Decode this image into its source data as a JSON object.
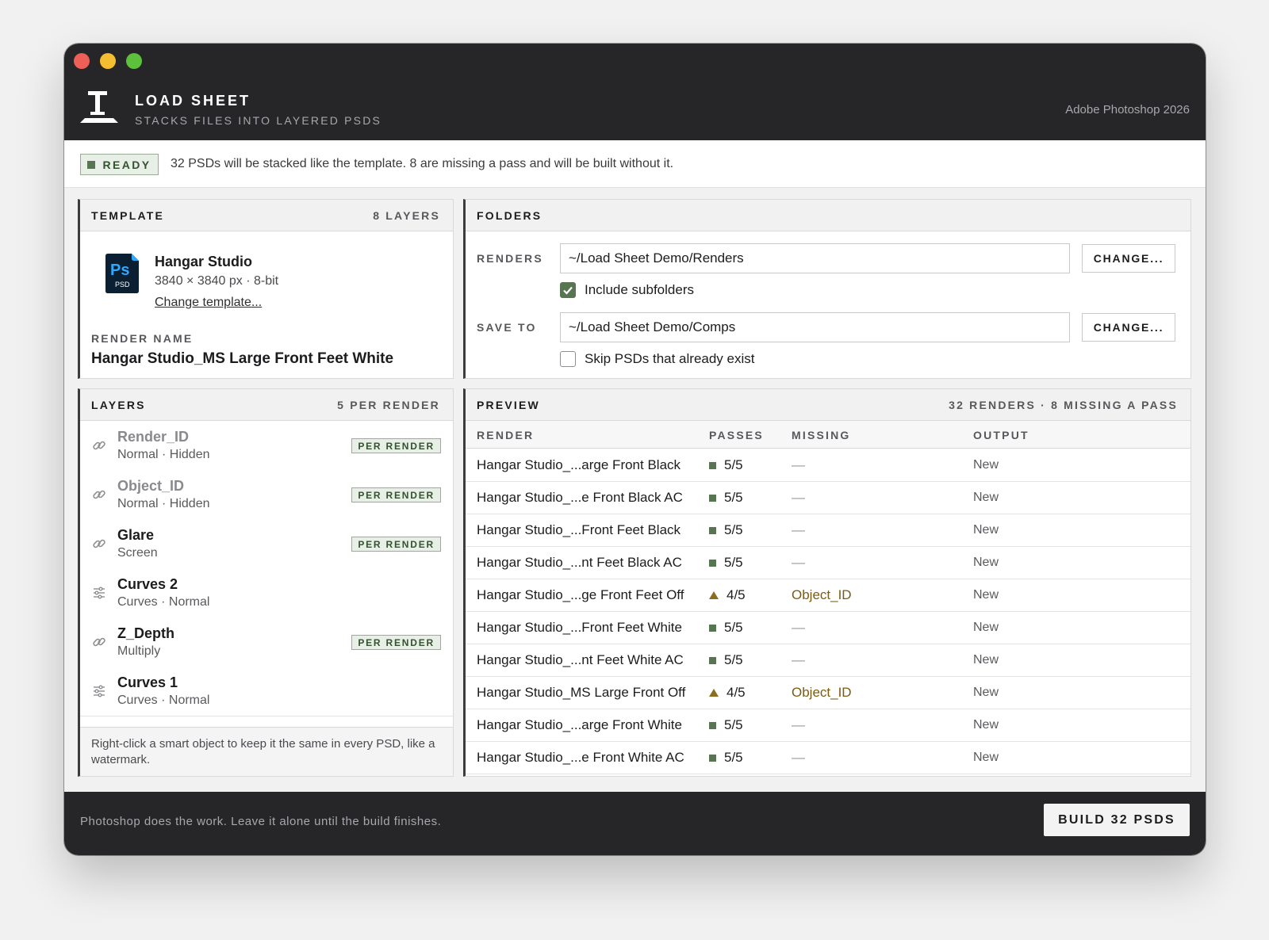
{
  "app": {
    "title": "LOAD SHEET",
    "subtitle": "STACKS FILES INTO LAYERED PSDS",
    "host": "Adobe Photoshop 2026"
  },
  "status": {
    "badge": "READY",
    "message": "32 PSDs will be stacked like the template. 8 are missing a pass and will be built without it."
  },
  "template": {
    "heading": "TEMPLATE",
    "layer_count": "8 LAYERS",
    "icon_text": "Ps",
    "icon_sub": "PSD",
    "name": "Hangar Studio",
    "dims": "3840 × 3840 px  ·  8-bit",
    "change_link": "Change template...",
    "render_name_label": "RENDER NAME",
    "render_name": "Hangar Studio_MS Large Front Feet White"
  },
  "folders": {
    "heading": "FOLDERS",
    "renders_label": "RENDERS",
    "renders_path": "~/Load Sheet Demo/Renders",
    "renders_button": "CHANGE...",
    "include_subfolders_label": "Include subfolders",
    "include_subfolders_checked": true,
    "save_to_label": "SAVE TO",
    "save_to_path": "~/Load Sheet Demo/Comps",
    "save_to_button": "CHANGE...",
    "skip_existing_label": "Skip PSDs that already exist",
    "skip_existing_checked": false
  },
  "layers": {
    "heading": "LAYERS",
    "meta": "5 PER RENDER",
    "items": [
      {
        "name": "Render_ID",
        "sub": "Normal · Hidden",
        "icon": "link-icon",
        "badge": "PER RENDER",
        "hidden": true
      },
      {
        "name": "Object_ID",
        "sub": "Normal · Hidden",
        "icon": "link-icon",
        "badge": "PER RENDER",
        "hidden": true
      },
      {
        "name": "Glare",
        "sub": "Screen",
        "icon": "link-icon",
        "badge": "PER RENDER",
        "hidden": false
      },
      {
        "name": "Curves 2",
        "sub": "Curves · Normal",
        "icon": "adjustment-icon",
        "badge": "",
        "hidden": false
      },
      {
        "name": "Z_Depth",
        "sub": "Multiply",
        "icon": "link-icon",
        "badge": "PER RENDER",
        "hidden": false
      },
      {
        "name": "Curves 1",
        "sub": "Curves · Normal",
        "icon": "adjustment-icon",
        "badge": "",
        "hidden": false
      }
    ],
    "footer": "Right-click a smart object to keep it the same in every PSD, like a watermark."
  },
  "preview": {
    "heading": "PREVIEW",
    "meta": "32 RENDERS  ·  8 MISSING A PASS",
    "columns": [
      "RENDER",
      "PASSES",
      "MISSING",
      "OUTPUT"
    ],
    "rows": [
      {
        "render": "Hangar Studio_...arge Front Black",
        "passes": "5/5",
        "status": "ok",
        "missing": "—",
        "output": "New"
      },
      {
        "render": "Hangar Studio_...e Front Black AC",
        "passes": "5/5",
        "status": "ok",
        "missing": "—",
        "output": "New"
      },
      {
        "render": "Hangar Studio_...Front Feet Black",
        "passes": "5/5",
        "status": "ok",
        "missing": "—",
        "output": "New"
      },
      {
        "render": "Hangar Studio_...nt Feet Black AC",
        "passes": "5/5",
        "status": "ok",
        "missing": "—",
        "output": "New"
      },
      {
        "render": "Hangar Studio_...ge Front Feet Off",
        "passes": "4/5",
        "status": "warn",
        "missing": "Object_ID",
        "output": "New"
      },
      {
        "render": "Hangar Studio_...Front Feet White",
        "passes": "5/5",
        "status": "ok",
        "missing": "—",
        "output": "New"
      },
      {
        "render": "Hangar Studio_...nt Feet White AC",
        "passes": "5/5",
        "status": "ok",
        "missing": "—",
        "output": "New"
      },
      {
        "render": "Hangar Studio_MS Large Front Off",
        "passes": "4/5",
        "status": "warn",
        "missing": "Object_ID",
        "output": "New"
      },
      {
        "render": "Hangar Studio_...arge Front White",
        "passes": "5/5",
        "status": "ok",
        "missing": "—",
        "output": "New"
      },
      {
        "render": "Hangar Studio_...e Front White AC",
        "passes": "5/5",
        "status": "ok",
        "missing": "—",
        "output": "New"
      }
    ]
  },
  "footer": {
    "note": "Photoshop does the work. Leave it alone until the build finishes.",
    "build_button": "BUILD 32 PSDS"
  },
  "colors": {
    "accent_green": "#577551",
    "warning": "#8a6d1e",
    "chrome_dark": "#262628"
  }
}
